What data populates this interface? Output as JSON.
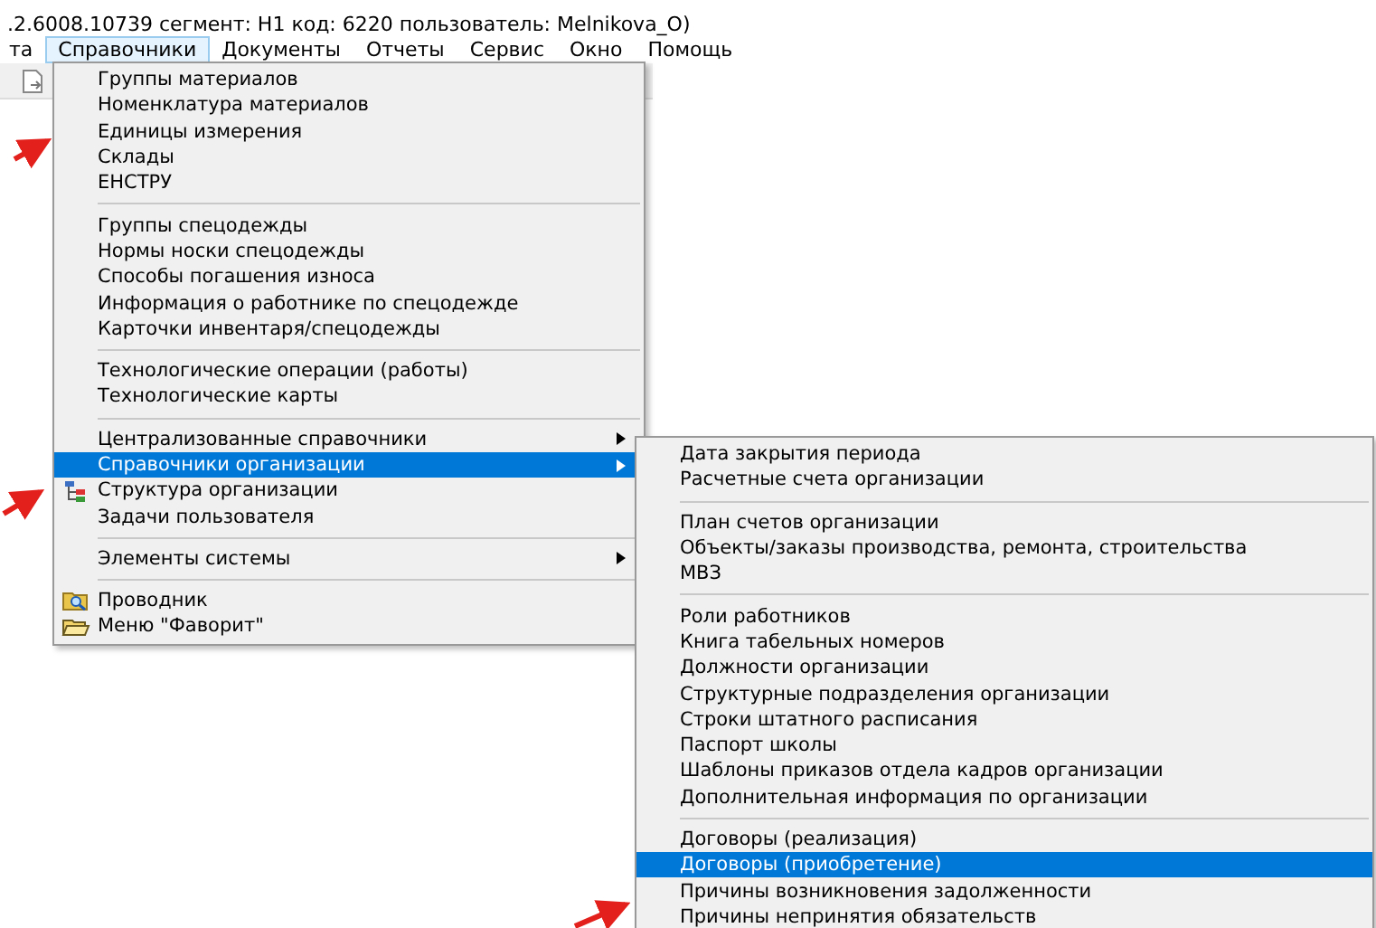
{
  "window": {
    "title": ".2.6008.10739 сегмент: Н1 код: 6220 пользователь: Melnikova_O)"
  },
  "menubar": [
    {
      "label": "та",
      "selected": false
    },
    {
      "label": "Справочники",
      "selected": true
    },
    {
      "label": "Документы",
      "selected": false
    },
    {
      "label": "Отчеты",
      "selected": false
    },
    {
      "label": "Сервис",
      "selected": false
    },
    {
      "label": "Окно",
      "selected": false
    },
    {
      "label": "Помощь",
      "selected": false
    }
  ],
  "menu": {
    "items": [
      {
        "kind": "item",
        "label": "Группы материалов",
        "selected": false,
        "submenu": false
      },
      {
        "kind": "item",
        "label": "Номенклатура материалов",
        "selected": false,
        "submenu": false
      },
      {
        "kind": "item",
        "label": "Единицы измерения",
        "selected": false,
        "submenu": false
      },
      {
        "kind": "item",
        "label": "Склады",
        "selected": false,
        "submenu": false
      },
      {
        "kind": "item",
        "label": "ЕНСТРУ",
        "selected": false,
        "submenu": false
      },
      {
        "kind": "separator"
      },
      {
        "kind": "item",
        "label": "Группы спецодежды",
        "selected": false,
        "submenu": false
      },
      {
        "kind": "item",
        "label": "Нормы носки спецодежды",
        "selected": false,
        "submenu": false
      },
      {
        "kind": "item",
        "label": "Способы погашения износа",
        "selected": false,
        "submenu": false
      },
      {
        "kind": "item",
        "label": "Информация о работнике по спецодежде",
        "selected": false,
        "submenu": false
      },
      {
        "kind": "item",
        "label": "Карточки инвентаря/спецодежды",
        "selected": false,
        "submenu": false
      },
      {
        "kind": "separator"
      },
      {
        "kind": "item",
        "label": "Технологические операции (работы)",
        "selected": false,
        "submenu": false
      },
      {
        "kind": "item",
        "label": "Технологические карты",
        "selected": false,
        "submenu": false
      },
      {
        "kind": "separator"
      },
      {
        "kind": "item",
        "label": "Централизованные справочники",
        "selected": false,
        "submenu": true
      },
      {
        "kind": "item",
        "label": "Справочники организации",
        "selected": true,
        "submenu": true
      },
      {
        "kind": "tree",
        "label": "Структура организации",
        "selected": false,
        "submenu": false
      },
      {
        "kind": "item",
        "label": "Задачи пользователя",
        "selected": false,
        "submenu": false
      },
      {
        "kind": "separator"
      },
      {
        "kind": "item",
        "label": "Элементы системы",
        "selected": false,
        "submenu": true
      },
      {
        "kind": "separator"
      },
      {
        "kind": "explorer",
        "label": "Проводник",
        "selected": false,
        "submenu": false
      },
      {
        "kind": "favorites",
        "label": "Меню \"Фаворит\"",
        "selected": false,
        "submenu": false
      }
    ]
  },
  "submenu": {
    "items": [
      {
        "kind": "item",
        "label": "Дата закрытия периода",
        "selected": false
      },
      {
        "kind": "item",
        "label": "Расчетные счета организации",
        "selected": false
      },
      {
        "kind": "separator"
      },
      {
        "kind": "item",
        "label": "План счетов организации",
        "selected": false
      },
      {
        "kind": "item",
        "label": "Объекты/заказы производства, ремонта, строительства",
        "selected": false
      },
      {
        "kind": "item",
        "label": "МВЗ",
        "selected": false
      },
      {
        "kind": "separator"
      },
      {
        "kind": "item",
        "label": "Роли работников",
        "selected": false
      },
      {
        "kind": "item",
        "label": "Книга табельных номеров",
        "selected": false
      },
      {
        "kind": "item",
        "label": "Должности организации",
        "selected": false
      },
      {
        "kind": "item",
        "label": "Структурные подразделения организации",
        "selected": false
      },
      {
        "kind": "item",
        "label": "Строки штатного расписания",
        "selected": false
      },
      {
        "kind": "item",
        "label": "Паспорт школы",
        "selected": false
      },
      {
        "kind": "item",
        "label": "Шаблоны приказов отдела кадров организации",
        "selected": false
      },
      {
        "kind": "item",
        "label": "Дополнительная информация по организации",
        "selected": false
      },
      {
        "kind": "separator"
      },
      {
        "kind": "item",
        "label": "Договоры (реализация)",
        "selected": false
      },
      {
        "kind": "item",
        "label": "Договоры (приобретение)",
        "selected": true
      },
      {
        "kind": "item",
        "label": "Причины возникновения задолженности",
        "selected": false
      },
      {
        "kind": "item",
        "label": "Причины непринятия обязательств",
        "selected": false
      }
    ]
  }
}
